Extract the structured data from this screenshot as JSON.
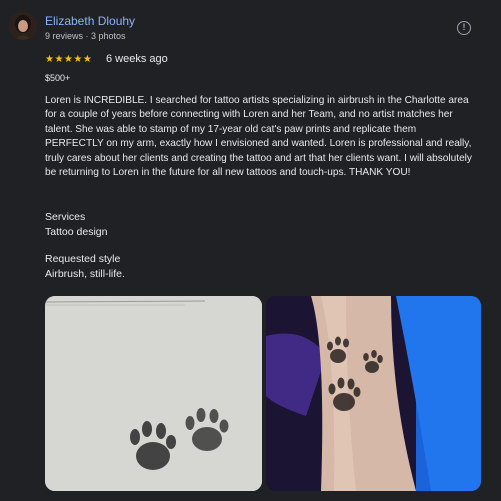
{
  "reviewer": {
    "name": "Elizabeth Dlouhy",
    "meta": "9 reviews · 3 photos"
  },
  "rating": {
    "stars": 5,
    "stars_text": "★★★★★",
    "date": "6 weeks ago"
  },
  "price": "$500+",
  "review_text": "Loren is INCREDIBLE. I searched for tattoo artists specializing in airbrush in the Charlotte area for a couple of years before connecting with Loren and her Team, and no artist matches her talent. She was able to stamp of my 17-year old cat's paw prints and replicate them PERFECTLY on my arm, exactly how I envisioned and wanted. Loren is professional and really, truly cares about her clients and creating the tattoo and art that her clients want. I will absolutely be returning to Loren in the future for all new tattoos and touch-ups. THANK YOU!",
  "services": {
    "label": "Services",
    "value": "Tattoo design"
  },
  "requested_style": {
    "label": "Requested style",
    "value": "Airbrush, still-life."
  },
  "colors": {
    "link": "#8ab4f8",
    "star": "#fbbc04",
    "background": "#202124"
  },
  "icons": {
    "more_info": "info-circle-icon"
  }
}
